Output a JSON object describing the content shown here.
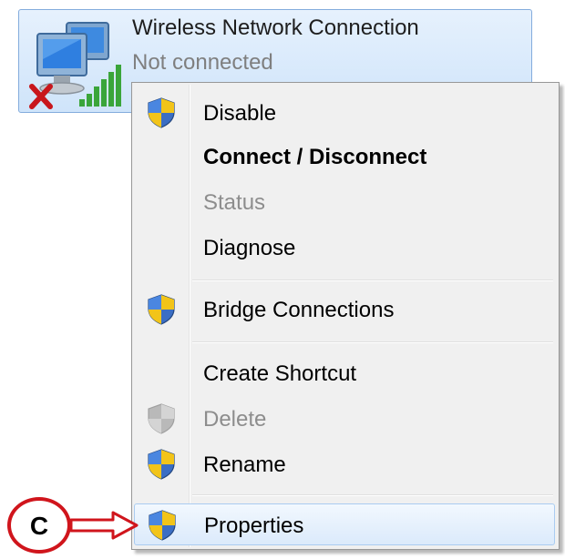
{
  "connection": {
    "name": "Wireless Network Connection",
    "status": "Not connected",
    "icon": "wireless-network-adapter-icon",
    "error_icon": "red-x-icon",
    "signal_icon": "signal-bars-icon"
  },
  "context_menu": {
    "items": [
      {
        "label": "Disable",
        "icon": "uac-shield-icon"
      },
      {
        "label": "Connect / Disconnect",
        "bold": true
      },
      {
        "label": "Status",
        "disabled": true
      },
      {
        "label": "Diagnose"
      },
      {
        "label": "Bridge Connections",
        "icon": "uac-shield-icon"
      },
      {
        "label": "Create Shortcut"
      },
      {
        "label": "Delete",
        "icon": "uac-shield-icon",
        "disabled": true
      },
      {
        "label": "Rename",
        "icon": "uac-shield-icon"
      },
      {
        "label": "Properties",
        "icon": "uac-shield-icon",
        "highlighted": true
      }
    ]
  },
  "annotation": {
    "letter": "C",
    "color": "#d0151c"
  }
}
